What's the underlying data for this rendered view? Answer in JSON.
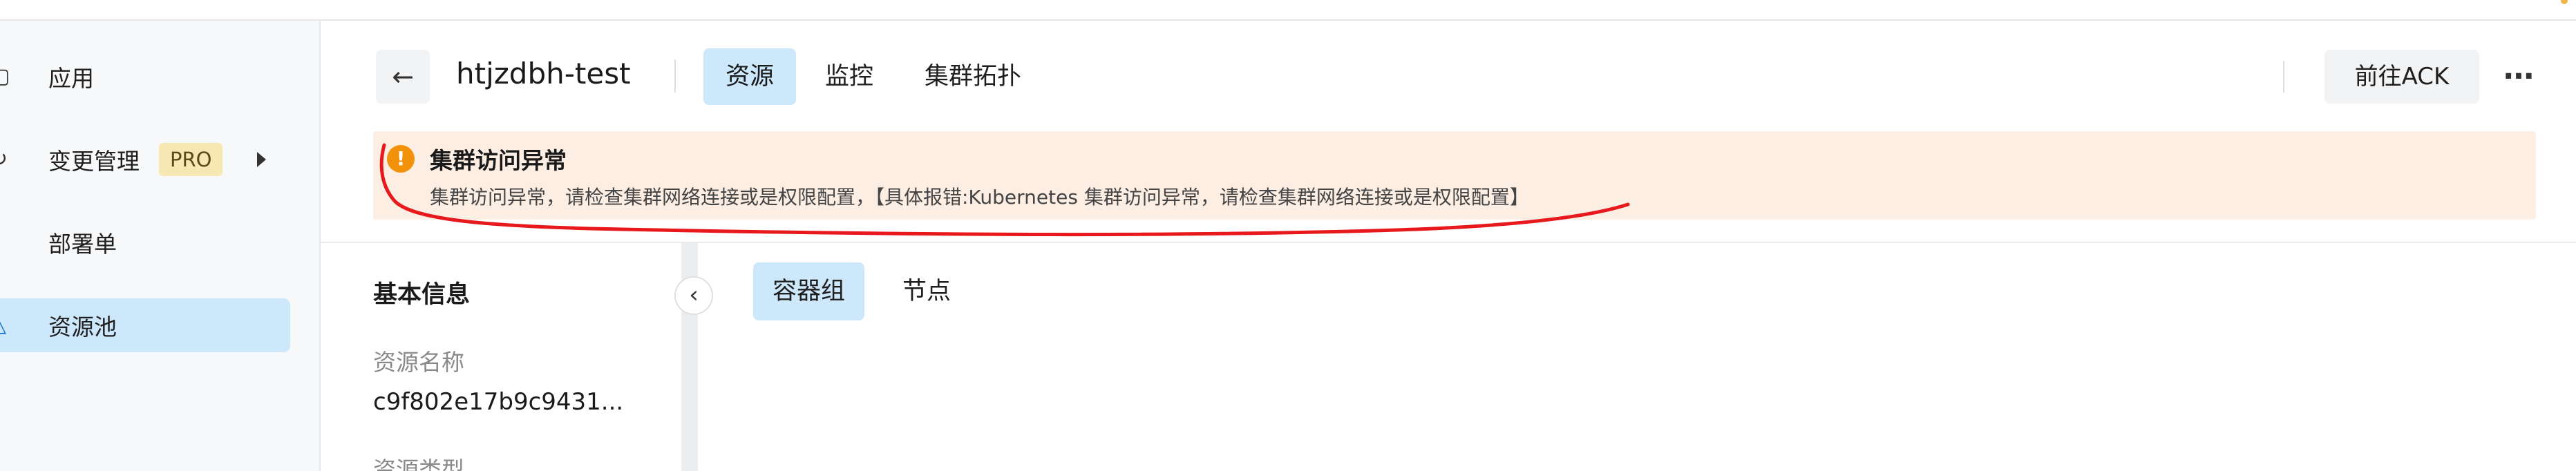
{
  "colors": {
    "accent_bg": "#cde7fb",
    "accent": "#1677d2",
    "alert_bg": "#fdeee4",
    "alert_icon": "#f2910a",
    "annotation": "#e8191c",
    "pro_badge_bg": "#f7e8b3"
  },
  "sidebar": {
    "items": [
      {
        "label": "应用",
        "icon": "app-icon"
      },
      {
        "label": "变更管理",
        "icon": "change-icon",
        "badge": "PRO"
      },
      {
        "label": "部署单",
        "icon": "deploy-icon"
      },
      {
        "label": "资源池",
        "icon": "resource-pool-icon",
        "active": true
      }
    ]
  },
  "header": {
    "title": "htjzdbh-test",
    "tabs": [
      {
        "label": "资源",
        "active": true
      },
      {
        "label": "监控"
      },
      {
        "label": "集群拓扑"
      }
    ],
    "ack_button": "前往ACK",
    "more_icon": "ellipsis-icon"
  },
  "alert": {
    "title": "集群访问异常",
    "message": "集群访问异常，请检查集群网络连接或是权限配置，【具体报错:Kubernetes 集群访问异常，请检查集群网络连接或是权限配置】",
    "icon": "warning-icon"
  },
  "info": {
    "heading": "基本信息",
    "resource_name_label": "资源名称",
    "resource_name_value": "c9f802e17b9c9431...",
    "resource_type_label": "资源类型"
  },
  "subtabs": [
    {
      "label": "容器组",
      "active": true
    },
    {
      "label": "节点"
    }
  ]
}
